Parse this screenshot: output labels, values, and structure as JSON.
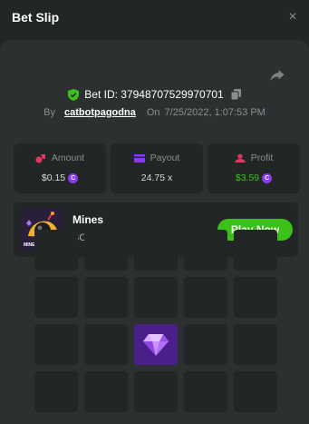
{
  "header": {
    "title": "Bet Slip",
    "close_glyph": "×"
  },
  "bet": {
    "id_label": "Bet ID: 37948707529970701",
    "by_label": "By",
    "username": "catbotpagodna",
    "on_label": "On",
    "datetime": "7/25/2022, 1:07:53 PM"
  },
  "stats": {
    "amount": {
      "label": "Amount",
      "value": "$0.15",
      "icon": "coins-icon",
      "color": "#e0385e"
    },
    "payout": {
      "label": "Payout",
      "value": "24.75 x",
      "icon": "wallet-icon",
      "color": "#8a3bf1"
    },
    "profit": {
      "label": "Profit",
      "value": "$3.59",
      "icon": "profit-icon",
      "color": "#e0385e",
      "value_color": "#3bc117"
    }
  },
  "currency_glyph": "C",
  "game": {
    "name": "Mines",
    "subtitle": "BC Original",
    "thumb_label": "MINE",
    "play_label": "Play Now"
  },
  "board": {
    "columns": 5,
    "visible_rows": 4,
    "gem_position": {
      "row": 3,
      "col": 3
    }
  },
  "colors": {
    "accent_green": "#3bc117",
    "gem_tile": "#4a1f8a",
    "coin": "#8a3bf1"
  }
}
